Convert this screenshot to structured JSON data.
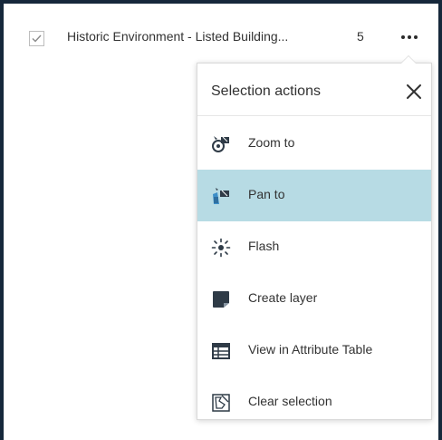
{
  "layer": {
    "name": "Historic Environment - Listed Building...",
    "count": "5",
    "checked": true
  },
  "menu": {
    "title": "Selection actions",
    "items": [
      {
        "label": "Zoom to",
        "icon": "zoom-to-icon",
        "active": false
      },
      {
        "label": "Pan to",
        "icon": "pan-to-icon",
        "active": true
      },
      {
        "label": "Flash",
        "icon": "flash-icon",
        "active": false
      },
      {
        "label": "Create layer",
        "icon": "create-layer-icon",
        "active": false
      },
      {
        "label": "View in Attribute Table",
        "icon": "table-icon",
        "active": false
      },
      {
        "label": "Clear selection",
        "icon": "clear-selection-icon",
        "active": false
      }
    ]
  },
  "colors": {
    "frame": "#16283b",
    "highlight": "#b7dbe4",
    "icon_dark": "#2f3b47",
    "icon_accent": "#1f8fd6"
  }
}
